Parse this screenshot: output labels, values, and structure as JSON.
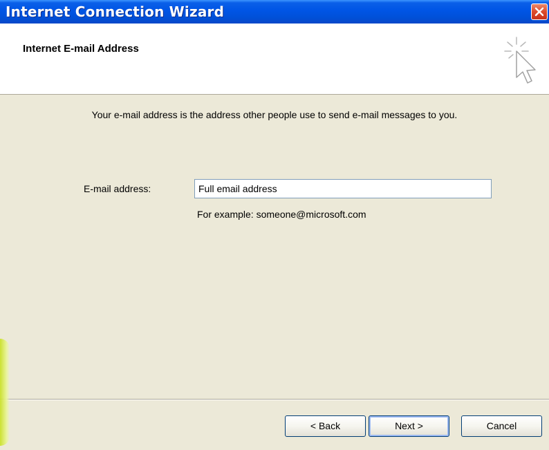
{
  "window": {
    "title": "Internet Connection Wizard"
  },
  "header": {
    "title": "Internet E-mail Address",
    "icon": "wizard-cursor-icon"
  },
  "main": {
    "intro": "Your e-mail address is the address other people use to send e-mail messages to you.",
    "email_label": "E-mail address:",
    "email_value": "Full email address",
    "example": "For example: someone@microsoft.com"
  },
  "buttons": {
    "back": "< Back",
    "next": "Next >",
    "cancel": "Cancel"
  },
  "colors": {
    "titlebar": "#0055e5",
    "dialog": "#ece9d8",
    "close": "#dd4a2a"
  }
}
